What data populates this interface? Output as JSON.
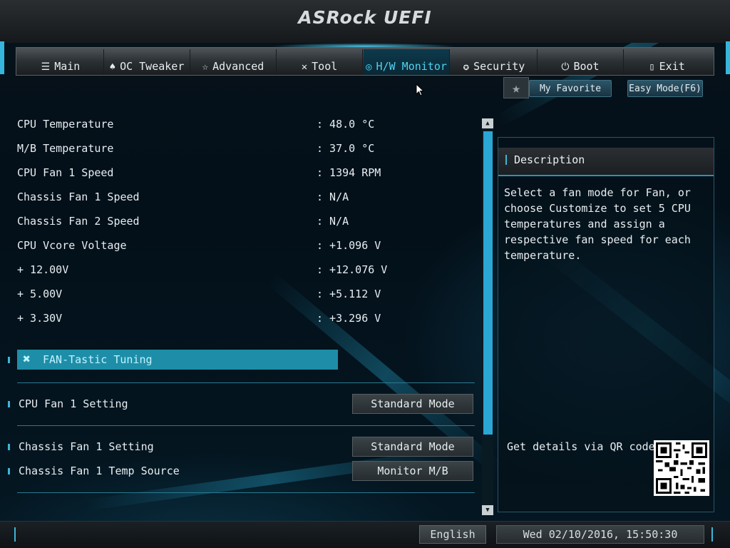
{
  "header": {
    "logo_text": "ASRock UEFI"
  },
  "tabs": [
    {
      "label": "Main",
      "icon": "list-icon",
      "glyph": "☰",
      "active": false
    },
    {
      "label": "OC Tweaker",
      "icon": "rocket-icon",
      "glyph": "♠",
      "active": false
    },
    {
      "label": "Advanced",
      "icon": "star-icon",
      "glyph": "☆",
      "active": false
    },
    {
      "label": "Tool",
      "icon": "tools-icon",
      "glyph": "✕",
      "active": false
    },
    {
      "label": "H/W Monitor",
      "icon": "monitor-gauge-icon",
      "glyph": "◎",
      "active": true
    },
    {
      "label": "Security",
      "icon": "shield-icon",
      "glyph": "✪",
      "active": false
    },
    {
      "label": "Boot",
      "icon": "power-icon",
      "glyph": "⏻",
      "active": false
    },
    {
      "label": "Exit",
      "icon": "exit-door-icon",
      "glyph": "▯",
      "active": false
    }
  ],
  "top_buttons": {
    "favorite": "My Favorite",
    "easy_mode": "Easy Mode(F6)"
  },
  "monitor": {
    "rows": [
      {
        "label": "CPU Temperature",
        "value": ": 48.0 °C"
      },
      {
        "label": "M/B Temperature",
        "value": ": 37.0 °C"
      },
      {
        "label": "CPU Fan 1 Speed",
        "value": ": 1394 RPM"
      },
      {
        "label": "Chassis Fan 1 Speed",
        "value": ": N/A"
      },
      {
        "label": "Chassis Fan 2 Speed",
        "value": ": N/A"
      },
      {
        "label": "CPU Vcore Voltage",
        "value": ": +1.096 V"
      },
      {
        "label": "+ 12.00V",
        "value": ": +12.076 V"
      },
      {
        "label": "+ 5.00V",
        "value": ": +5.112 V"
      },
      {
        "label": "+ 3.30V",
        "value": ": +3.296 V"
      }
    ]
  },
  "fan_tuning": {
    "label": "FAN-Tastic Tuning"
  },
  "settings": {
    "cpu_fan_1": {
      "label": "CPU Fan 1 Setting",
      "value": "Standard Mode"
    },
    "chassis_fan_1": {
      "label": "Chassis Fan 1 Setting",
      "value": "Standard Mode"
    },
    "chassis_fan_1_temp": {
      "label": "Chassis Fan 1 Temp Source",
      "value": "Monitor M/B"
    }
  },
  "description": {
    "title": "Description",
    "text": "Select a fan mode for Fan, or choose Customize to set 5 CPU temperatures and assign a respective fan speed for each temperature.",
    "qr_label": "Get details via QR code"
  },
  "bottom": {
    "language": "English",
    "datetime": "Wed 02/10/2016, 15:50:30"
  },
  "colors": {
    "accent": "#2aa7d4",
    "active_tab_text": "#4fd2f0",
    "section_bar": "#1e8ea8"
  }
}
